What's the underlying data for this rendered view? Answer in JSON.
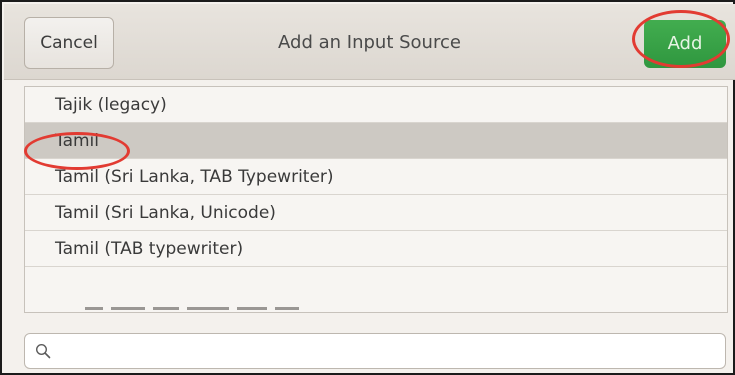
{
  "dialog": {
    "title": "Add an Input Source",
    "cancel_label": "Cancel",
    "add_label": "Add"
  },
  "list": {
    "items": [
      {
        "label": "Tajik (legacy)"
      },
      {
        "label": "Tamil",
        "selected": true
      },
      {
        "label": "Tamil (Sri Lanka, TAB Typewriter)"
      },
      {
        "label": "Tamil (Sri Lanka, Unicode)"
      },
      {
        "label": "Tamil (TAB typewriter)"
      }
    ]
  },
  "search": {
    "value": "",
    "placeholder": ""
  },
  "colors": {
    "add_button": "#35a045",
    "selected_row": "#cdc9c3",
    "annotation_ring": "#e23b32"
  },
  "icons": {
    "search": "search-icon"
  }
}
